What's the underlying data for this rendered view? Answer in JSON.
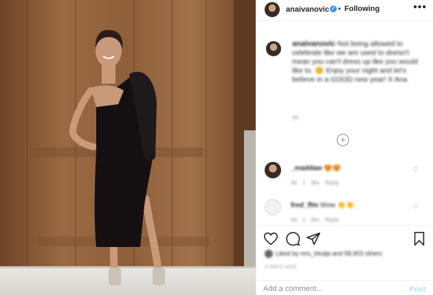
{
  "header": {
    "username": "anaivanovic",
    "separator": "•",
    "follow_status": "Following",
    "more_label": "•••"
  },
  "caption": {
    "username": "anaivanovic",
    "text": "Not being allowed to celebrate like we are used to doesn't mean you can't dress up like you would like to. 😊 Enjoy your night and let's believe in a GOOD new year! X Ana",
    "meta": "4d"
  },
  "load_more": "+",
  "comments": [
    {
      "username": "_maddaw",
      "text": "😍😍",
      "meta": "4d  1 like  Reply"
    },
    {
      "username": "fred_ffm",
      "text": "Wow 👏👏",
      "meta": "4d  1 like  Reply"
    }
  ],
  "actions": {
    "like_icon": "heart-icon",
    "comment_icon": "comment-icon",
    "share_icon": "paper-plane-icon",
    "save_icon": "bookmark-icon"
  },
  "likes_text": "Liked by mrs_trkulja and 58,903 others",
  "date": "4 DAYS AGO",
  "add_comment": {
    "placeholder": "Add a comment...",
    "post_label": "Post"
  },
  "colors": {
    "link_blue": "#3897f0",
    "post_disabled": "#b2dffc",
    "muted": "#8e8e8e",
    "wood": "#8a5a37"
  }
}
